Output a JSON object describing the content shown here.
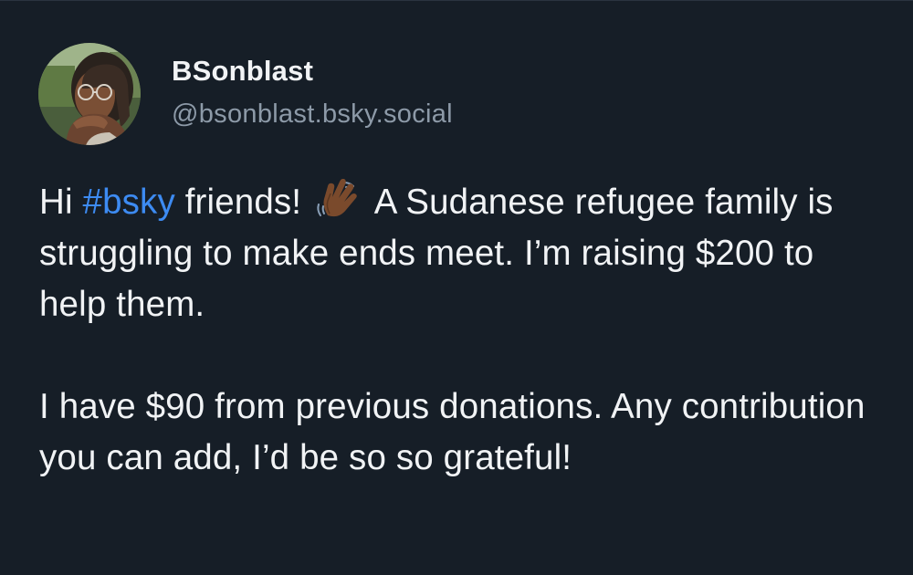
{
  "post": {
    "author": {
      "display_name": "BSonblast",
      "handle": "@bsonblast.bsky.social",
      "avatar_icon": "avatar-photo"
    },
    "text": {
      "p1_before_tag": "Hi ",
      "hashtag": "#bsky",
      "p1_after_tag": " friends! ",
      "emoji": "waving-hand-medium-dark-skin-tone",
      "p1_after_emoji": " A Sudanese refugee family is struggling to make ends meet. I’m raising $200 to help them.",
      "p2": "I have $90 from previous donations. Any contribution you can add, I’d be so so grateful!"
    }
  },
  "colors": {
    "background": "#161e27",
    "text": "#f1f3f5",
    "handle": "#8d9aa8",
    "link": "#3d8bf2"
  }
}
